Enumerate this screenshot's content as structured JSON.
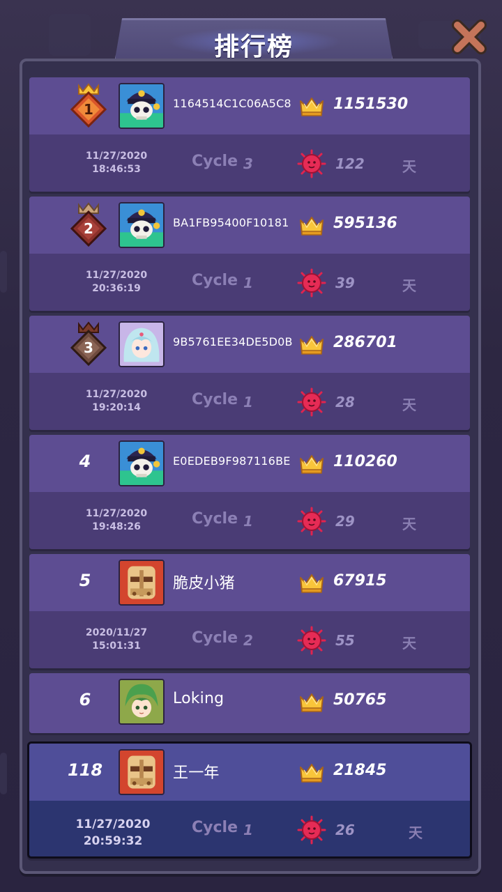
{
  "title": "排行榜",
  "entries": [
    {
      "rank": "1",
      "badge": "gold-crown-badge",
      "avatar": "skull-pirate",
      "name": "1164514C1C06A5C8",
      "score": "1151530",
      "date": "11/27/2020",
      "time": "18:46:53",
      "cycle_label": "Cycle",
      "cycle": "3",
      "days": "122",
      "day_unit": "天"
    },
    {
      "rank": "2",
      "badge": "silver-crown-badge",
      "avatar": "skull-pirate",
      "name": "BA1FB95400F10181",
      "score": "595136",
      "date": "11/27/2020",
      "time": "20:36:19",
      "cycle_label": "Cycle",
      "cycle": "1",
      "days": "39",
      "day_unit": "天"
    },
    {
      "rank": "3",
      "badge": "bronze-crown-badge",
      "avatar": "girl-blue-hair",
      "name": "9B5761EE34DE5D0B",
      "score": "286701",
      "date": "11/27/2020",
      "time": "19:20:14",
      "cycle_label": "Cycle",
      "cycle": "1",
      "days": "28",
      "day_unit": "天"
    },
    {
      "rank": "4",
      "avatar": "skull-pirate",
      "name": "E0EDEB9F987116BE",
      "score": "110260",
      "date": "11/27/2020",
      "time": "19:48:26",
      "cycle_label": "Cycle",
      "cycle": "1",
      "days": "29",
      "day_unit": "天"
    },
    {
      "rank": "5",
      "avatar": "masked-warrior",
      "name": "脆皮小猪",
      "score": "67915",
      "date": "2020/11/27",
      "time": "15:01:31",
      "cycle_label": "Cycle",
      "cycle": "2",
      "days": "55",
      "day_unit": "天"
    },
    {
      "rank": "6",
      "avatar": "green-hair-boy",
      "name": "Loking",
      "score": "50765"
    }
  ],
  "self_entry": {
    "rank": "118",
    "avatar": "masked-warrior",
    "name": "王一年",
    "score": "21845",
    "date": "11/27/2020",
    "time": "20:59:32",
    "cycle_label": "Cycle",
    "cycle": "1",
    "days": "26",
    "day_unit": "天"
  },
  "colors": {
    "card_top": "#5d4d92",
    "card_bottom": "#4a3c75",
    "self_top": "#4f4e99",
    "self_bottom": "#2c3570",
    "crown": "#f5b92b",
    "virus": "#e0244f"
  }
}
